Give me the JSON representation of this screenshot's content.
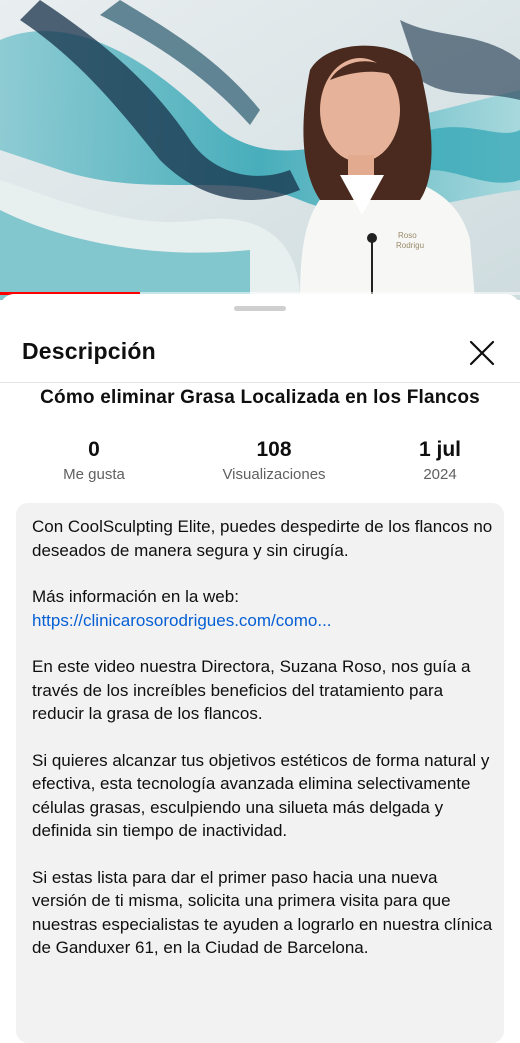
{
  "video": {
    "progress_fraction": 0.27,
    "thumbnail_colors": {
      "teal": "#2ea4b3",
      "navy": "#17324a",
      "white": "#f4f6f5",
      "coat": "#f7f7f5",
      "hair": "#4a2a1e"
    }
  },
  "sheet": {
    "title": "Descripción",
    "close_icon": "close-icon"
  },
  "video_title": "Cómo eliminar Grasa Localizada en los Flancos",
  "stats": {
    "likes": {
      "value": "0",
      "label": "Me gusta"
    },
    "views": {
      "value": "108",
      "label": "Visualizaciones"
    },
    "date": {
      "value": "1 jul",
      "label": "2024"
    }
  },
  "description": {
    "p1": "Con CoolSculpting Elite, puedes despedirte de los flancos no deseados de manera segura y sin cirugía.",
    "p2_text": "Más información en la web:",
    "p2_link": "https://clinicarosorodrigues.com/como...",
    "p3": "En este video nuestra Directora, Suzana Roso, nos guía a través de los increíbles beneficios del tratamiento para reducir la grasa de los flancos.",
    "p4": "Si quieres alcanzar tus objetivos estéticos de forma natural y efectiva, esta tecnología avanzada elimina selectivamente células grasas, esculpiendo una silueta más delgada y definida sin tiempo de inactividad.",
    "p5": "Si estas lista para dar el primer paso hacia una nueva versión de ti misma, solicita una primera visita para que nuestras especialistas te ayuden a lograrlo en nuestra clínica de Ganduxer 61, en la Ciudad de Barcelona."
  },
  "colors": {
    "link": "#065fd4",
    "progress": "#ff0000",
    "muted": "#606060",
    "box": "#f2f2f2"
  }
}
